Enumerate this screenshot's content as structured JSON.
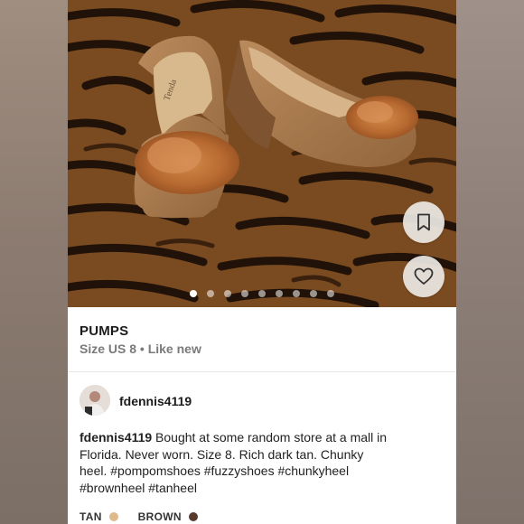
{
  "listing": {
    "title": "PUMPS",
    "meta": "Size US 8 • Like new",
    "image_count": 9,
    "active_image": 1
  },
  "seller": {
    "username": "fdennis4119"
  },
  "description": {
    "author": "fdennis4119",
    "text": " Bought at some random store at a mall in\nFlorida. Never worn. Size 8. Rich dark tan. Chunky\nheel. #pompomshoes #fuzzyshoes #chunkyheel\n#brownheel #tanheel"
  },
  "colors": [
    {
      "label": "TAN",
      "hex": "#e0b98a"
    },
    {
      "label": "BROWN",
      "hex": "#5a3a2c"
    }
  ],
  "icons": {
    "bookmark": "bookmark-icon",
    "like": "heart-icon"
  }
}
